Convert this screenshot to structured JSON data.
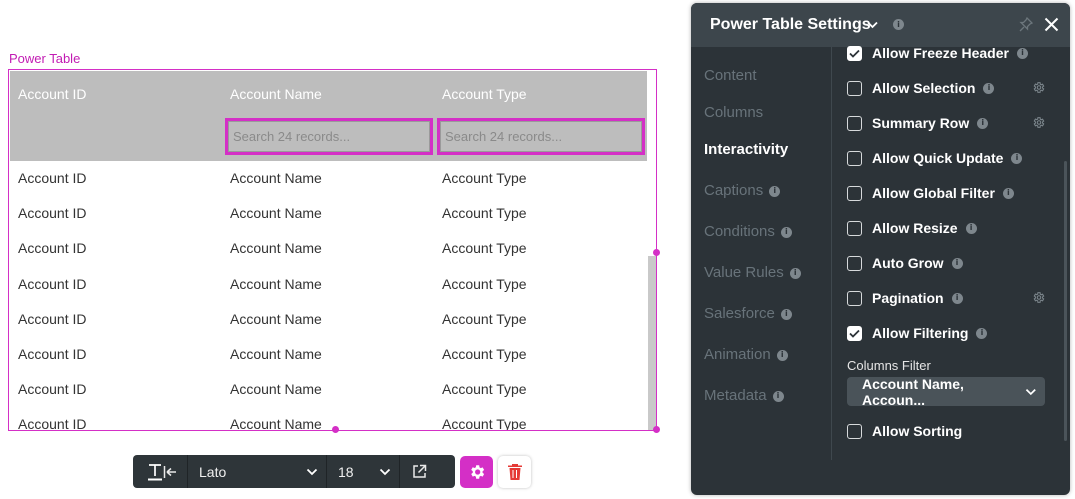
{
  "canvas": {
    "component_label": "Power Table",
    "table": {
      "columns": [
        "Account ID",
        "Account Name",
        "Account Type"
      ],
      "search_placeholder": "Search 24 records...",
      "rows": [
        [
          "Account ID",
          "Account Name",
          "Account Type"
        ],
        [
          "Account ID",
          "Account Name",
          "Account Type"
        ],
        [
          "Account ID",
          "Account Name",
          "Account Type"
        ],
        [
          "Account ID",
          "Account Name",
          "Account Type"
        ],
        [
          "Account ID",
          "Account Name",
          "Account Type"
        ],
        [
          "Account ID",
          "Account Name",
          "Account Type"
        ],
        [
          "Account ID",
          "Account Name",
          "Account Type"
        ],
        [
          "Account ID",
          "Account Name",
          "Account Type"
        ]
      ]
    }
  },
  "toolbar": {
    "font_family": "Lato",
    "font_size": "18"
  },
  "panel": {
    "title": "Power Table Settings",
    "nav": [
      {
        "label": "Content",
        "info": false,
        "active": false
      },
      {
        "label": "Columns",
        "info": false,
        "active": false
      },
      {
        "label": "Interactivity",
        "info": false,
        "active": true
      },
      {
        "label": "Captions",
        "info": true,
        "active": false
      },
      {
        "label": "Conditions",
        "info": true,
        "active": false
      },
      {
        "label": "Value Rules",
        "info": true,
        "active": false
      },
      {
        "label": "Salesforce",
        "info": true,
        "active": false
      },
      {
        "label": "Animation",
        "info": true,
        "active": false
      },
      {
        "label": "Metadata",
        "info": true,
        "active": false
      }
    ],
    "options": [
      {
        "label": "Allow Freeze Header",
        "checked": true,
        "gear": false
      },
      {
        "label": "Allow Selection",
        "checked": false,
        "gear": true
      },
      {
        "label": "Summary Row",
        "checked": false,
        "gear": true
      },
      {
        "label": "Allow Quick Update",
        "checked": false,
        "gear": false
      },
      {
        "label": "Allow Global Filter",
        "checked": false,
        "gear": false
      },
      {
        "label": "Allow Resize",
        "checked": false,
        "gear": false
      },
      {
        "label": "Auto Grow",
        "checked": false,
        "gear": false
      },
      {
        "label": "Pagination",
        "checked": false,
        "gear": true
      },
      {
        "label": "Allow Filtering",
        "checked": true,
        "gear": false
      }
    ],
    "columns_filter_label": "Columns Filter",
    "columns_filter_value": "Account Name, Accoun...",
    "sorting_label": "Allow Sorting",
    "sorting_checked": false
  },
  "colors": {
    "accent": "#d42fc6",
    "panel_bg": "#2c3338",
    "header_bg": "#bdbdbd"
  },
  "icons": [
    "text-style-icon",
    "align-left-icon",
    "chevron-down-icon",
    "external-link-icon",
    "gear-icon",
    "trash-icon",
    "info-icon",
    "pin-icon",
    "close-icon",
    "check-icon"
  ]
}
